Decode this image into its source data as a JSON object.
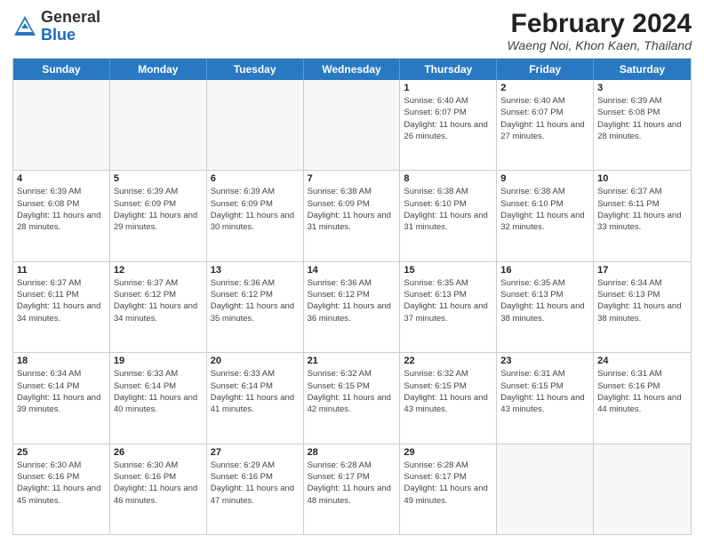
{
  "header": {
    "logo_general": "General",
    "logo_blue": "Blue",
    "month_year": "February 2024",
    "location": "Waeng Noi, Khon Kaen, Thailand"
  },
  "weekdays": [
    "Sunday",
    "Monday",
    "Tuesday",
    "Wednesday",
    "Thursday",
    "Friday",
    "Saturday"
  ],
  "rows": [
    [
      {
        "day": "",
        "info": ""
      },
      {
        "day": "",
        "info": ""
      },
      {
        "day": "",
        "info": ""
      },
      {
        "day": "",
        "info": ""
      },
      {
        "day": "1",
        "info": "Sunrise: 6:40 AM\nSunset: 6:07 PM\nDaylight: 11 hours and 26 minutes."
      },
      {
        "day": "2",
        "info": "Sunrise: 6:40 AM\nSunset: 6:07 PM\nDaylight: 11 hours and 27 minutes."
      },
      {
        "day": "3",
        "info": "Sunrise: 6:39 AM\nSunset: 6:08 PM\nDaylight: 11 hours and 28 minutes."
      }
    ],
    [
      {
        "day": "4",
        "info": "Sunrise: 6:39 AM\nSunset: 6:08 PM\nDaylight: 11 hours and 28 minutes."
      },
      {
        "day": "5",
        "info": "Sunrise: 6:39 AM\nSunset: 6:09 PM\nDaylight: 11 hours and 29 minutes."
      },
      {
        "day": "6",
        "info": "Sunrise: 6:39 AM\nSunset: 6:09 PM\nDaylight: 11 hours and 30 minutes."
      },
      {
        "day": "7",
        "info": "Sunrise: 6:38 AM\nSunset: 6:09 PM\nDaylight: 11 hours and 31 minutes."
      },
      {
        "day": "8",
        "info": "Sunrise: 6:38 AM\nSunset: 6:10 PM\nDaylight: 11 hours and 31 minutes."
      },
      {
        "day": "9",
        "info": "Sunrise: 6:38 AM\nSunset: 6:10 PM\nDaylight: 11 hours and 32 minutes."
      },
      {
        "day": "10",
        "info": "Sunrise: 6:37 AM\nSunset: 6:11 PM\nDaylight: 11 hours and 33 minutes."
      }
    ],
    [
      {
        "day": "11",
        "info": "Sunrise: 6:37 AM\nSunset: 6:11 PM\nDaylight: 11 hours and 34 minutes."
      },
      {
        "day": "12",
        "info": "Sunrise: 6:37 AM\nSunset: 6:12 PM\nDaylight: 11 hours and 34 minutes."
      },
      {
        "day": "13",
        "info": "Sunrise: 6:36 AM\nSunset: 6:12 PM\nDaylight: 11 hours and 35 minutes."
      },
      {
        "day": "14",
        "info": "Sunrise: 6:36 AM\nSunset: 6:12 PM\nDaylight: 11 hours and 36 minutes."
      },
      {
        "day": "15",
        "info": "Sunrise: 6:35 AM\nSunset: 6:13 PM\nDaylight: 11 hours and 37 minutes."
      },
      {
        "day": "16",
        "info": "Sunrise: 6:35 AM\nSunset: 6:13 PM\nDaylight: 11 hours and 38 minutes."
      },
      {
        "day": "17",
        "info": "Sunrise: 6:34 AM\nSunset: 6:13 PM\nDaylight: 11 hours and 38 minutes."
      }
    ],
    [
      {
        "day": "18",
        "info": "Sunrise: 6:34 AM\nSunset: 6:14 PM\nDaylight: 11 hours and 39 minutes."
      },
      {
        "day": "19",
        "info": "Sunrise: 6:33 AM\nSunset: 6:14 PM\nDaylight: 11 hours and 40 minutes."
      },
      {
        "day": "20",
        "info": "Sunrise: 6:33 AM\nSunset: 6:14 PM\nDaylight: 11 hours and 41 minutes."
      },
      {
        "day": "21",
        "info": "Sunrise: 6:32 AM\nSunset: 6:15 PM\nDaylight: 11 hours and 42 minutes."
      },
      {
        "day": "22",
        "info": "Sunrise: 6:32 AM\nSunset: 6:15 PM\nDaylight: 11 hours and 43 minutes."
      },
      {
        "day": "23",
        "info": "Sunrise: 6:31 AM\nSunset: 6:15 PM\nDaylight: 11 hours and 43 minutes."
      },
      {
        "day": "24",
        "info": "Sunrise: 6:31 AM\nSunset: 6:16 PM\nDaylight: 11 hours and 44 minutes."
      }
    ],
    [
      {
        "day": "25",
        "info": "Sunrise: 6:30 AM\nSunset: 6:16 PM\nDaylight: 11 hours and 45 minutes."
      },
      {
        "day": "26",
        "info": "Sunrise: 6:30 AM\nSunset: 6:16 PM\nDaylight: 11 hours and 46 minutes."
      },
      {
        "day": "27",
        "info": "Sunrise: 6:29 AM\nSunset: 6:16 PM\nDaylight: 11 hours and 47 minutes."
      },
      {
        "day": "28",
        "info": "Sunrise: 6:28 AM\nSunset: 6:17 PM\nDaylight: 11 hours and 48 minutes."
      },
      {
        "day": "29",
        "info": "Sunrise: 6:28 AM\nSunset: 6:17 PM\nDaylight: 11 hours and 49 minutes."
      },
      {
        "day": "",
        "info": ""
      },
      {
        "day": "",
        "info": ""
      }
    ]
  ]
}
